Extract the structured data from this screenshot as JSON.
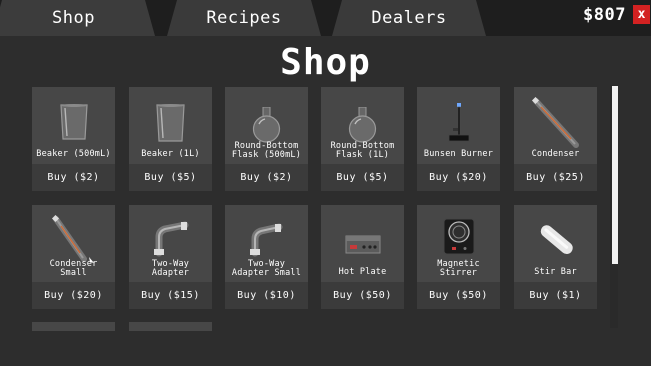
{
  "tabs": [
    {
      "label": "Shop",
      "active": true
    },
    {
      "label": "Recipes",
      "active": false
    },
    {
      "label": "Dealers",
      "active": false
    }
  ],
  "money": "$807",
  "close_label": "x",
  "title": "Shop",
  "colors": {
    "background": "#1e1e1e",
    "panel": "#2d2d2d",
    "card": "#474747",
    "card_button": "#3b3b3b",
    "close": "#d32222"
  },
  "items": [
    {
      "name": "Beaker (500mL)",
      "buy": "Buy ($2)",
      "icon": "beaker-icon"
    },
    {
      "name": "Beaker (1L)",
      "buy": "Buy ($5)",
      "icon": "beaker-large-icon"
    },
    {
      "name": "Round-Bottom Flask (500mL)",
      "name_lines": [
        "Round-Bottom",
        "Flask (500mL)"
      ],
      "buy": "Buy ($2)",
      "icon": "round-bottom-flask-icon"
    },
    {
      "name": "Round-Bottom Flask (1L)",
      "name_lines": [
        "Round-Bottom",
        "Flask (1L)"
      ],
      "buy": "Buy ($5)",
      "icon": "round-bottom-flask-icon"
    },
    {
      "name": "Bunsen Burner",
      "buy": "Buy ($20)",
      "icon": "bunsen-burner-icon"
    },
    {
      "name": "Condenser",
      "buy": "Buy ($25)",
      "icon": "condenser-icon"
    },
    {
      "name": "Condenser Small",
      "name_lines": [
        "Condenser",
        "Small"
      ],
      "buy": "Buy ($20)",
      "icon": "condenser-small-icon"
    },
    {
      "name": "Two-Way Adapter",
      "name_lines": [
        "Two-Way",
        "Adapter"
      ],
      "buy": "Buy ($15)",
      "icon": "two-way-adapter-icon"
    },
    {
      "name": "Two-Way Adapter Small",
      "name_lines": [
        "Two-Way",
        "Adapter Small"
      ],
      "buy": "Buy ($10)",
      "icon": "two-way-adapter-small-icon"
    },
    {
      "name": "Hot Plate",
      "buy": "Buy ($50)",
      "icon": "hot-plate-icon"
    },
    {
      "name": "Magnetic Stirrer",
      "name_lines": [
        "Magnetic",
        "Stirrer"
      ],
      "buy": "Buy ($50)",
      "icon": "magnetic-stirrer-icon"
    },
    {
      "name": "Stir Bar",
      "buy": "Buy ($1)",
      "icon": "stir-bar-icon"
    }
  ]
}
